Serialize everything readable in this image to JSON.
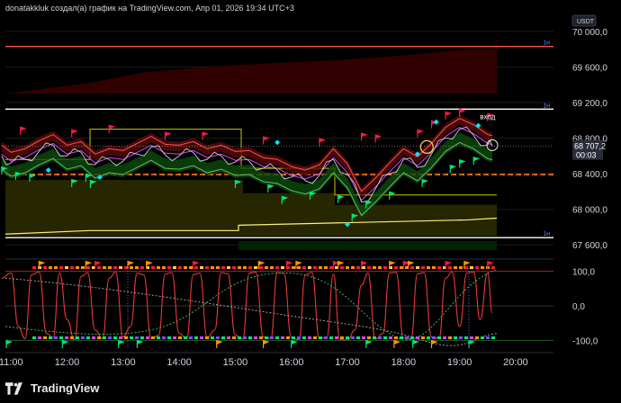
{
  "header": {
    "attribution": "donatakkluk создал(а) график на TradingView.com, Апр 01, 2026 19:34 UTC+3"
  },
  "price_axis": {
    "currency_label": "USDT",
    "current_price": "68 707,2",
    "countdown": "00:03"
  },
  "annotation": {
    "entry_label": "вход"
  },
  "brand": {
    "name": "TradingView"
  },
  "colors": {
    "background": "#000000",
    "axis_text": "#d1d4dc",
    "price_line": "#ffffff",
    "dashed_red": "#ff3b30",
    "dashed_orange": "#ff9800",
    "oscillator": "#e53935",
    "dotted_green": "#4caf50",
    "dotted_grey": "#9e9e9e"
  },
  "chart_data": [
    {
      "type": "line",
      "x_ticks": [
        "11:00",
        "12:00",
        "13:00",
        "14:00",
        "15:00",
        "16:00",
        "17:00",
        "18:00",
        "19:00",
        "20:00"
      ],
      "y_ticks": [
        "70 000,0",
        "69 600,0",
        "69 200,0",
        "68 800,0",
        "68 400,0",
        "68 000,0",
        "67 600,0"
      ],
      "y_tick_values": [
        70000,
        69600,
        69200,
        68800,
        68400,
        68000,
        67600
      ],
      "ylim": [
        67480,
        70150
      ],
      "horizontal_levels": [
        {
          "value": 69830,
          "label": "1н",
          "color": "#ff5252"
        },
        {
          "value": 69125,
          "label": "1н",
          "color": "#ffffff"
        },
        {
          "value": 68390,
          "label": "",
          "color": "#ff9800"
        },
        {
          "value": 67680,
          "label": "1н",
          "color": "#ffffff"
        }
      ],
      "price_series": {
        "name": "",
        "x": [
          "10:50",
          "11:00",
          "11:15",
          "11:30",
          "11:45",
          "12:00",
          "12:15",
          "12:30",
          "12:45",
          "13:00",
          "13:15",
          "13:30",
          "13:45",
          "14:00",
          "14:15",
          "14:30",
          "14:45",
          "15:00",
          "15:15",
          "15:30",
          "15:45",
          "16:00",
          "16:15",
          "16:30",
          "16:45",
          "17:00",
          "17:15",
          "17:30",
          "17:45",
          "18:00",
          "18:15",
          "18:30",
          "18:45",
          "19:00",
          "19:15",
          "19:30",
          "19:35"
        ],
        "values": [
          68600,
          68520,
          68560,
          68650,
          68720,
          68600,
          68640,
          68500,
          68560,
          68540,
          68620,
          68700,
          68610,
          68600,
          68640,
          68560,
          68600,
          68530,
          68540,
          68460,
          68440,
          68360,
          68320,
          68380,
          68560,
          68390,
          68080,
          68230,
          68400,
          68560,
          68470,
          68620,
          68800,
          68900,
          68830,
          68720,
          68707
        ]
      },
      "current_price": 68707.2
    },
    {
      "type": "line",
      "y_ticks": [
        "100,0",
        "0,0",
        "-100,0"
      ],
      "y_tick_values": [
        100,
        0,
        -100
      ],
      "ylim": [
        -125,
        125
      ],
      "oscillator": {
        "name": "",
        "x": [
          "10:50",
          "11:00",
          "11:08",
          "11:15",
          "11:22",
          "11:30",
          "11:38",
          "11:45",
          "11:52",
          "12:00",
          "12:08",
          "12:15",
          "12:22",
          "12:30",
          "12:38",
          "12:45",
          "12:52",
          "13:00",
          "13:08",
          "13:15",
          "13:22",
          "13:30",
          "13:38",
          "13:45",
          "13:52",
          "14:00",
          "14:08",
          "14:15",
          "14:22",
          "14:30",
          "14:38",
          "14:45",
          "14:52",
          "15:00",
          "15:08",
          "15:15",
          "15:22",
          "15:30",
          "15:38",
          "15:45",
          "15:52",
          "16:00",
          "16:08",
          "16:15",
          "16:22",
          "16:30",
          "16:38",
          "16:45",
          "16:52",
          "17:00",
          "17:08",
          "17:15",
          "17:22",
          "17:30",
          "17:38",
          "17:45",
          "17:52",
          "18:00",
          "18:08",
          "18:15",
          "18:22",
          "18:30",
          "18:38",
          "18:45",
          "18:52",
          "19:00",
          "19:08",
          "19:15",
          "19:22",
          "19:30",
          "19:35"
        ],
        "values": [
          80,
          95,
          -60,
          -95,
          90,
          98,
          -80,
          -92,
          95,
          -40,
          -98,
          85,
          96,
          -70,
          -95,
          80,
          98,
          -90,
          -60,
          95,
          90,
          -95,
          -85,
          92,
          96,
          -80,
          -95,
          90,
          95,
          -92,
          -70,
          96,
          93,
          -85,
          -96,
          95,
          98,
          -90,
          -94,
          96,
          94,
          -92,
          -98,
          90,
          97,
          -95,
          -90,
          92,
          -98,
          -99,
          -70,
          60,
          95,
          -96,
          -80,
          95,
          97,
          -92,
          -95,
          93,
          96,
          -90,
          -94,
          80,
          98,
          -60,
          96,
          98,
          -40,
          95,
          -20
        ]
      }
    }
  ]
}
